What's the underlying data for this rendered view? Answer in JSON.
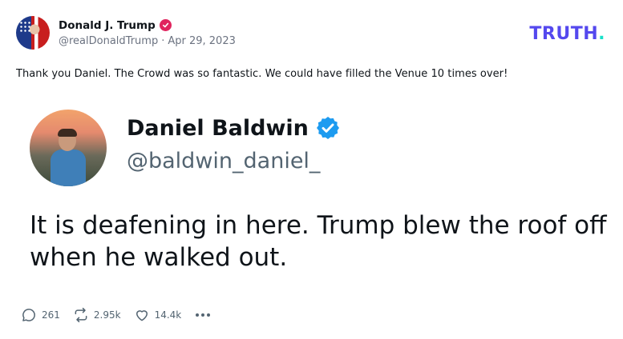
{
  "post": {
    "author_name": "Donald J. Trump",
    "author_handle": "@realDonaldTrump",
    "separator": "·",
    "date": "Apr 29, 2023",
    "text": "Thank you Daniel. The Crowd was so fantastic. We could have filled the Venue 10 times over!"
  },
  "brand": {
    "logo_text": "TRUTH",
    "logo_dot": ".",
    "colors": {
      "primary": "#5448ee",
      "dot": "#18e1c9"
    }
  },
  "embed": {
    "name": "Daniel Baldwin",
    "handle": "@baldwin_daniel_",
    "text": "It is deafening in here. Trump blew the roof off when he walked out."
  },
  "actions": {
    "replies": "261",
    "retruths": "2.95k",
    "likes": "14.4k"
  },
  "icons": {
    "verified_author": "verified-badge-icon",
    "verified_embed": "verified-badge-icon",
    "reply": "reply-icon",
    "retruth": "retruth-icon",
    "like": "heart-icon",
    "more": "more-icon"
  },
  "colors": {
    "verified_author": "#e0245e",
    "verified_embed": "#1d9bf0",
    "text": "#0f1419",
    "muted": "#536471"
  }
}
